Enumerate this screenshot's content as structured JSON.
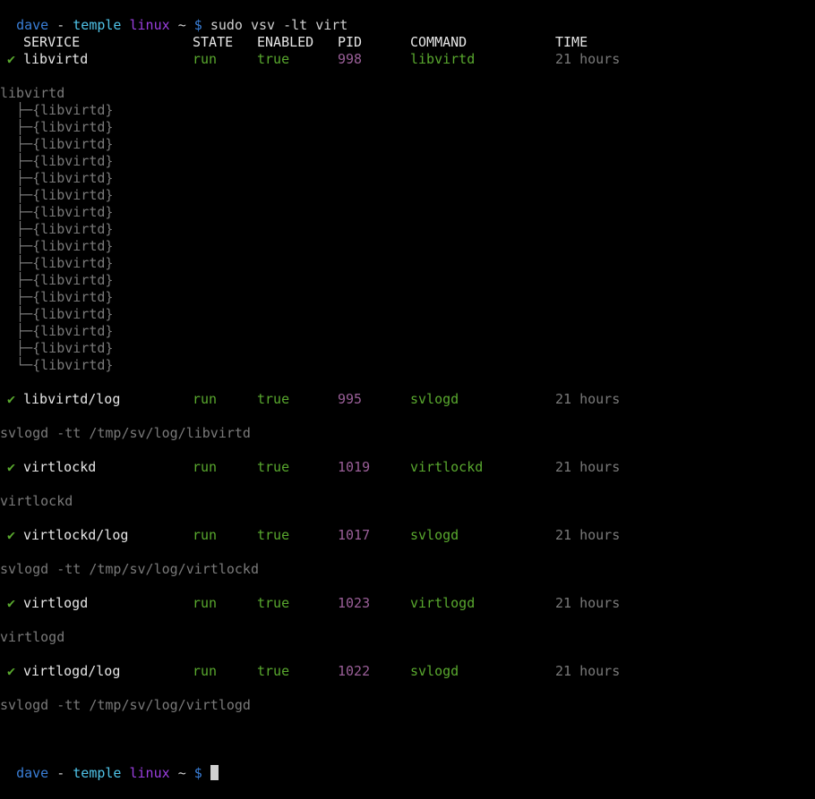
{
  "prompt": {
    "user": "dave",
    "separator": " - ",
    "host": "temple",
    "os": "linux",
    "cwd": "~",
    "symbol": "$",
    "command": "sudo vsv -lt virt"
  },
  "headers": {
    "service": "SERVICE",
    "state": "STATE",
    "enabled": "ENABLED",
    "pid": "PID",
    "command": "COMMAND",
    "time": "TIME"
  },
  "check_glyph": "✔",
  "services": [
    {
      "name": "libvirtd",
      "state": "run",
      "enabled": "true",
      "pid": "998",
      "command": "libvirtd",
      "time": "21 hours",
      "tree_root": "libvirtd",
      "tree_children": [
        "{libvirtd}",
        "{libvirtd}",
        "{libvirtd}",
        "{libvirtd}",
        "{libvirtd}",
        "{libvirtd}",
        "{libvirtd}",
        "{libvirtd}",
        "{libvirtd}",
        "{libvirtd}",
        "{libvirtd}",
        "{libvirtd}",
        "{libvirtd}",
        "{libvirtd}",
        "{libvirtd}",
        "{libvirtd}"
      ]
    },
    {
      "name": "libvirtd/log",
      "state": "run",
      "enabled": "true",
      "pid": "995",
      "command": "svlogd",
      "time": "21 hours",
      "detail": "svlogd -tt /tmp/sv/log/libvirtd"
    },
    {
      "name": "virtlockd",
      "state": "run",
      "enabled": "true",
      "pid": "1019",
      "command": "virtlockd",
      "time": "21 hours",
      "detail": "virtlockd"
    },
    {
      "name": "virtlockd/log",
      "state": "run",
      "enabled": "true",
      "pid": "1017",
      "command": "svlogd",
      "time": "21 hours",
      "detail": "svlogd -tt /tmp/sv/log/virtlockd"
    },
    {
      "name": "virtlogd",
      "state": "run",
      "enabled": "true",
      "pid": "1023",
      "command": "virtlogd",
      "time": "21 hours",
      "detail": "virtlogd"
    },
    {
      "name": "virtlogd/log",
      "state": "run",
      "enabled": "true",
      "pid": "1022",
      "command": "svlogd",
      "time": "21 hours",
      "detail": "svlogd -tt /tmp/sv/log/virtlogd"
    }
  ],
  "colors": {
    "background": "#000000",
    "ok_green": "#59a82e",
    "pid_purple": "#9a5f98",
    "dim_gray": "#7a7a7a",
    "prompt_blue": "#3a7fd8",
    "prompt_cyan": "#4fc3e8",
    "prompt_purple": "#9b3fe0"
  }
}
